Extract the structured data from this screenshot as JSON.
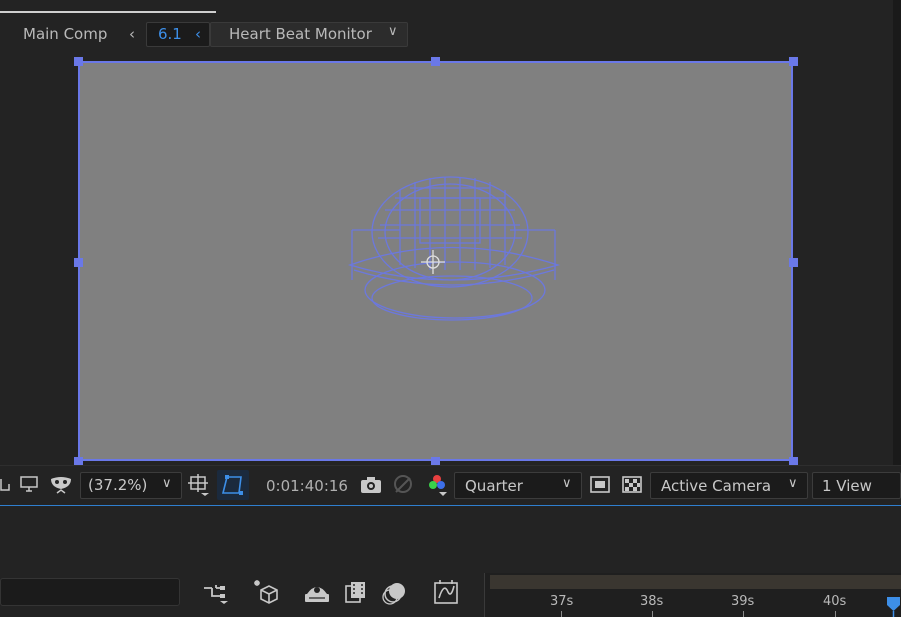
{
  "breadcrumb": {
    "main_comp": "Main Comp",
    "sub_comp": "6.1",
    "current_comp": "Heart Beat Monitor"
  },
  "viewer_toolbar": {
    "zoom": "(37.2%)",
    "timecode": "0:01:40:16",
    "resolution": "Quarter",
    "camera": "Active Camera",
    "views": "1 View"
  },
  "timeline": {
    "ticks": [
      "37s",
      "38s",
      "39s",
      "40s"
    ]
  },
  "colors": {
    "accent": "#3d8fe8",
    "selection": "#6a78e8",
    "comp_bg": "#808080",
    "panel_bg": "#232323"
  },
  "icons": {
    "toolbar": [
      "region-icon",
      "monitor-icon",
      "mask-icon",
      "safe-zones-icon",
      "roi-icon",
      "camera-snapshot-icon",
      "show-snapshot-icon",
      "color-channels-icon",
      "transparency-grid-icon",
      "fast-preview-icon"
    ],
    "timeline": [
      "composition-flowchart-icon",
      "3d-draft-icon",
      "shy-icon",
      "frame-blending-icon",
      "motion-blur-icon",
      "graph-editor-icon"
    ]
  }
}
